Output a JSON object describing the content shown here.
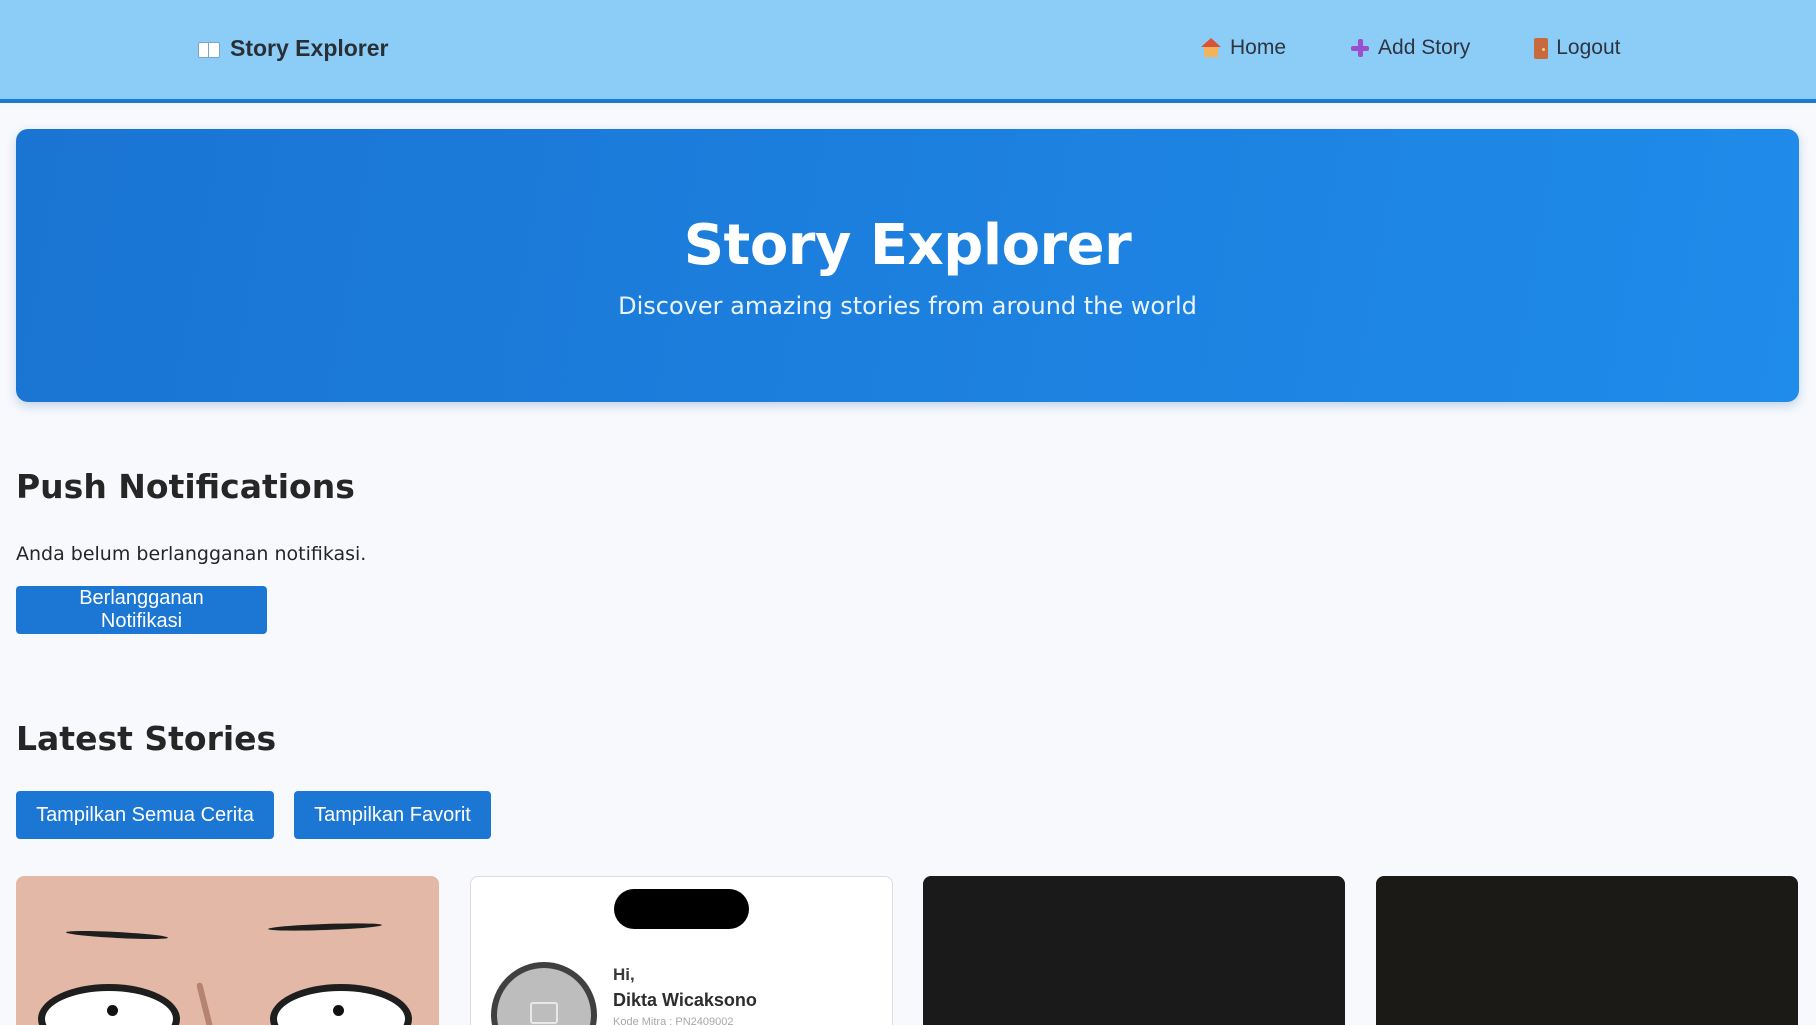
{
  "navbar": {
    "brand": "Story Explorer",
    "brand_icon": "open-book-icon",
    "links": [
      {
        "label": "Home",
        "icon": "house-icon"
      },
      {
        "label": "Add Story",
        "icon": "plus-icon"
      },
      {
        "label": "Logout",
        "icon": "door-icon"
      }
    ]
  },
  "hero": {
    "title": "Story Explorer",
    "subtitle": "Discover amazing stories from around the world"
  },
  "push": {
    "title": "Push Notifications",
    "status": "Anda belum berlangganan notifikasi.",
    "subscribe_label": "Berlangganan Notifikasi"
  },
  "stories": {
    "title": "Latest Stories",
    "show_all_label": "Tampilkan Semua Cerita",
    "show_favorites_label": "Tampilkan Favorit",
    "cards": [
      {
        "kind": "cartoon-face"
      },
      {
        "kind": "phone-screenshot",
        "greeting": "Hi,",
        "name": "Dikta Wicaksono",
        "code": "Kode Mitra : PN2409002"
      },
      {
        "kind": "dark-image"
      },
      {
        "kind": "dark-image"
      }
    ]
  },
  "colors": {
    "navbar_bg": "#8ccdf8",
    "primary": "#1b76d4",
    "page_bg": "#f7f9fc"
  }
}
